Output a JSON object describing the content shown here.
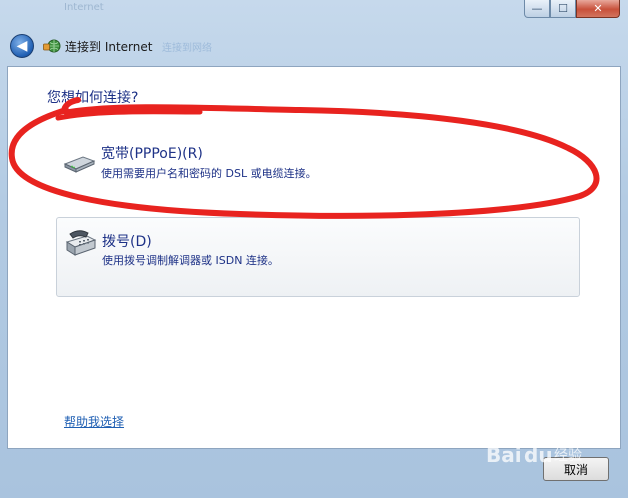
{
  "window": {
    "title_ghost": "Internet",
    "minimize_glyph": "—",
    "maximize_glyph": "☐",
    "close_glyph": "✕"
  },
  "nav": {
    "back_glyph": "◀",
    "title": "连接到 Internet",
    "ghost_text": "连接到网络"
  },
  "main": {
    "heading": "您想如何连接?",
    "options": [
      {
        "icon": "broadband-modem-icon",
        "title": "宽带(PPPoE)(R)",
        "description": "使用需要用户名和密码的 DSL 或电缆连接。"
      },
      {
        "icon": "dialup-phone-icon",
        "title": "拨号(D)",
        "description": "使用拨号调制解调器或 ISDN 连接。"
      }
    ],
    "help_link": "帮助我选择"
  },
  "footer": {
    "cancel_label": "取消"
  },
  "watermark": {
    "text": "Baidu 经验"
  },
  "colors": {
    "accent_text": "#1e3287",
    "link": "#1f5fb3",
    "annotation_red": "#e8231f"
  }
}
